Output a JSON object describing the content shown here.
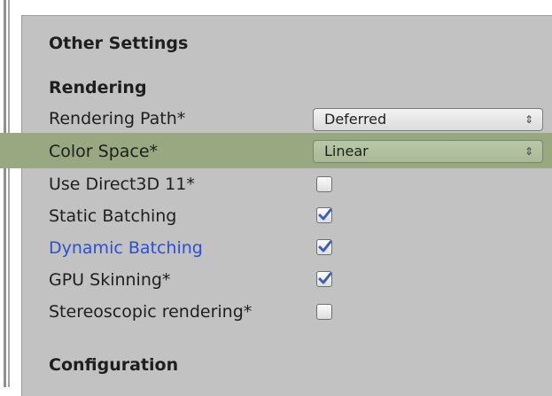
{
  "sections": {
    "other_settings": "Other Settings",
    "rendering": "Rendering",
    "configuration": "Configuration"
  },
  "rows": {
    "rendering_path": {
      "label": "Rendering Path*",
      "value": "Deferred"
    },
    "color_space": {
      "label": "Color Space*",
      "value": "Linear"
    },
    "use_direct3d_11": {
      "label": "Use Direct3D 11*",
      "checked": false
    },
    "static_batching": {
      "label": "Static Batching",
      "checked": true
    },
    "dynamic_batching": {
      "label": "Dynamic Batching",
      "checked": true
    },
    "gpu_skinning": {
      "label": "GPU Skinning*",
      "checked": true
    },
    "stereoscopic_rendering": {
      "label": "Stereoscopic rendering*",
      "checked": false
    }
  },
  "icons": {
    "dropdown": "updown-arrows-icon",
    "check": "checkmark-icon"
  },
  "colors": {
    "panel_bg": "#c2c2c2",
    "highlight": "#98a981",
    "link_blue": "#2d4fd1",
    "check_blue": "#3b5fb5"
  }
}
